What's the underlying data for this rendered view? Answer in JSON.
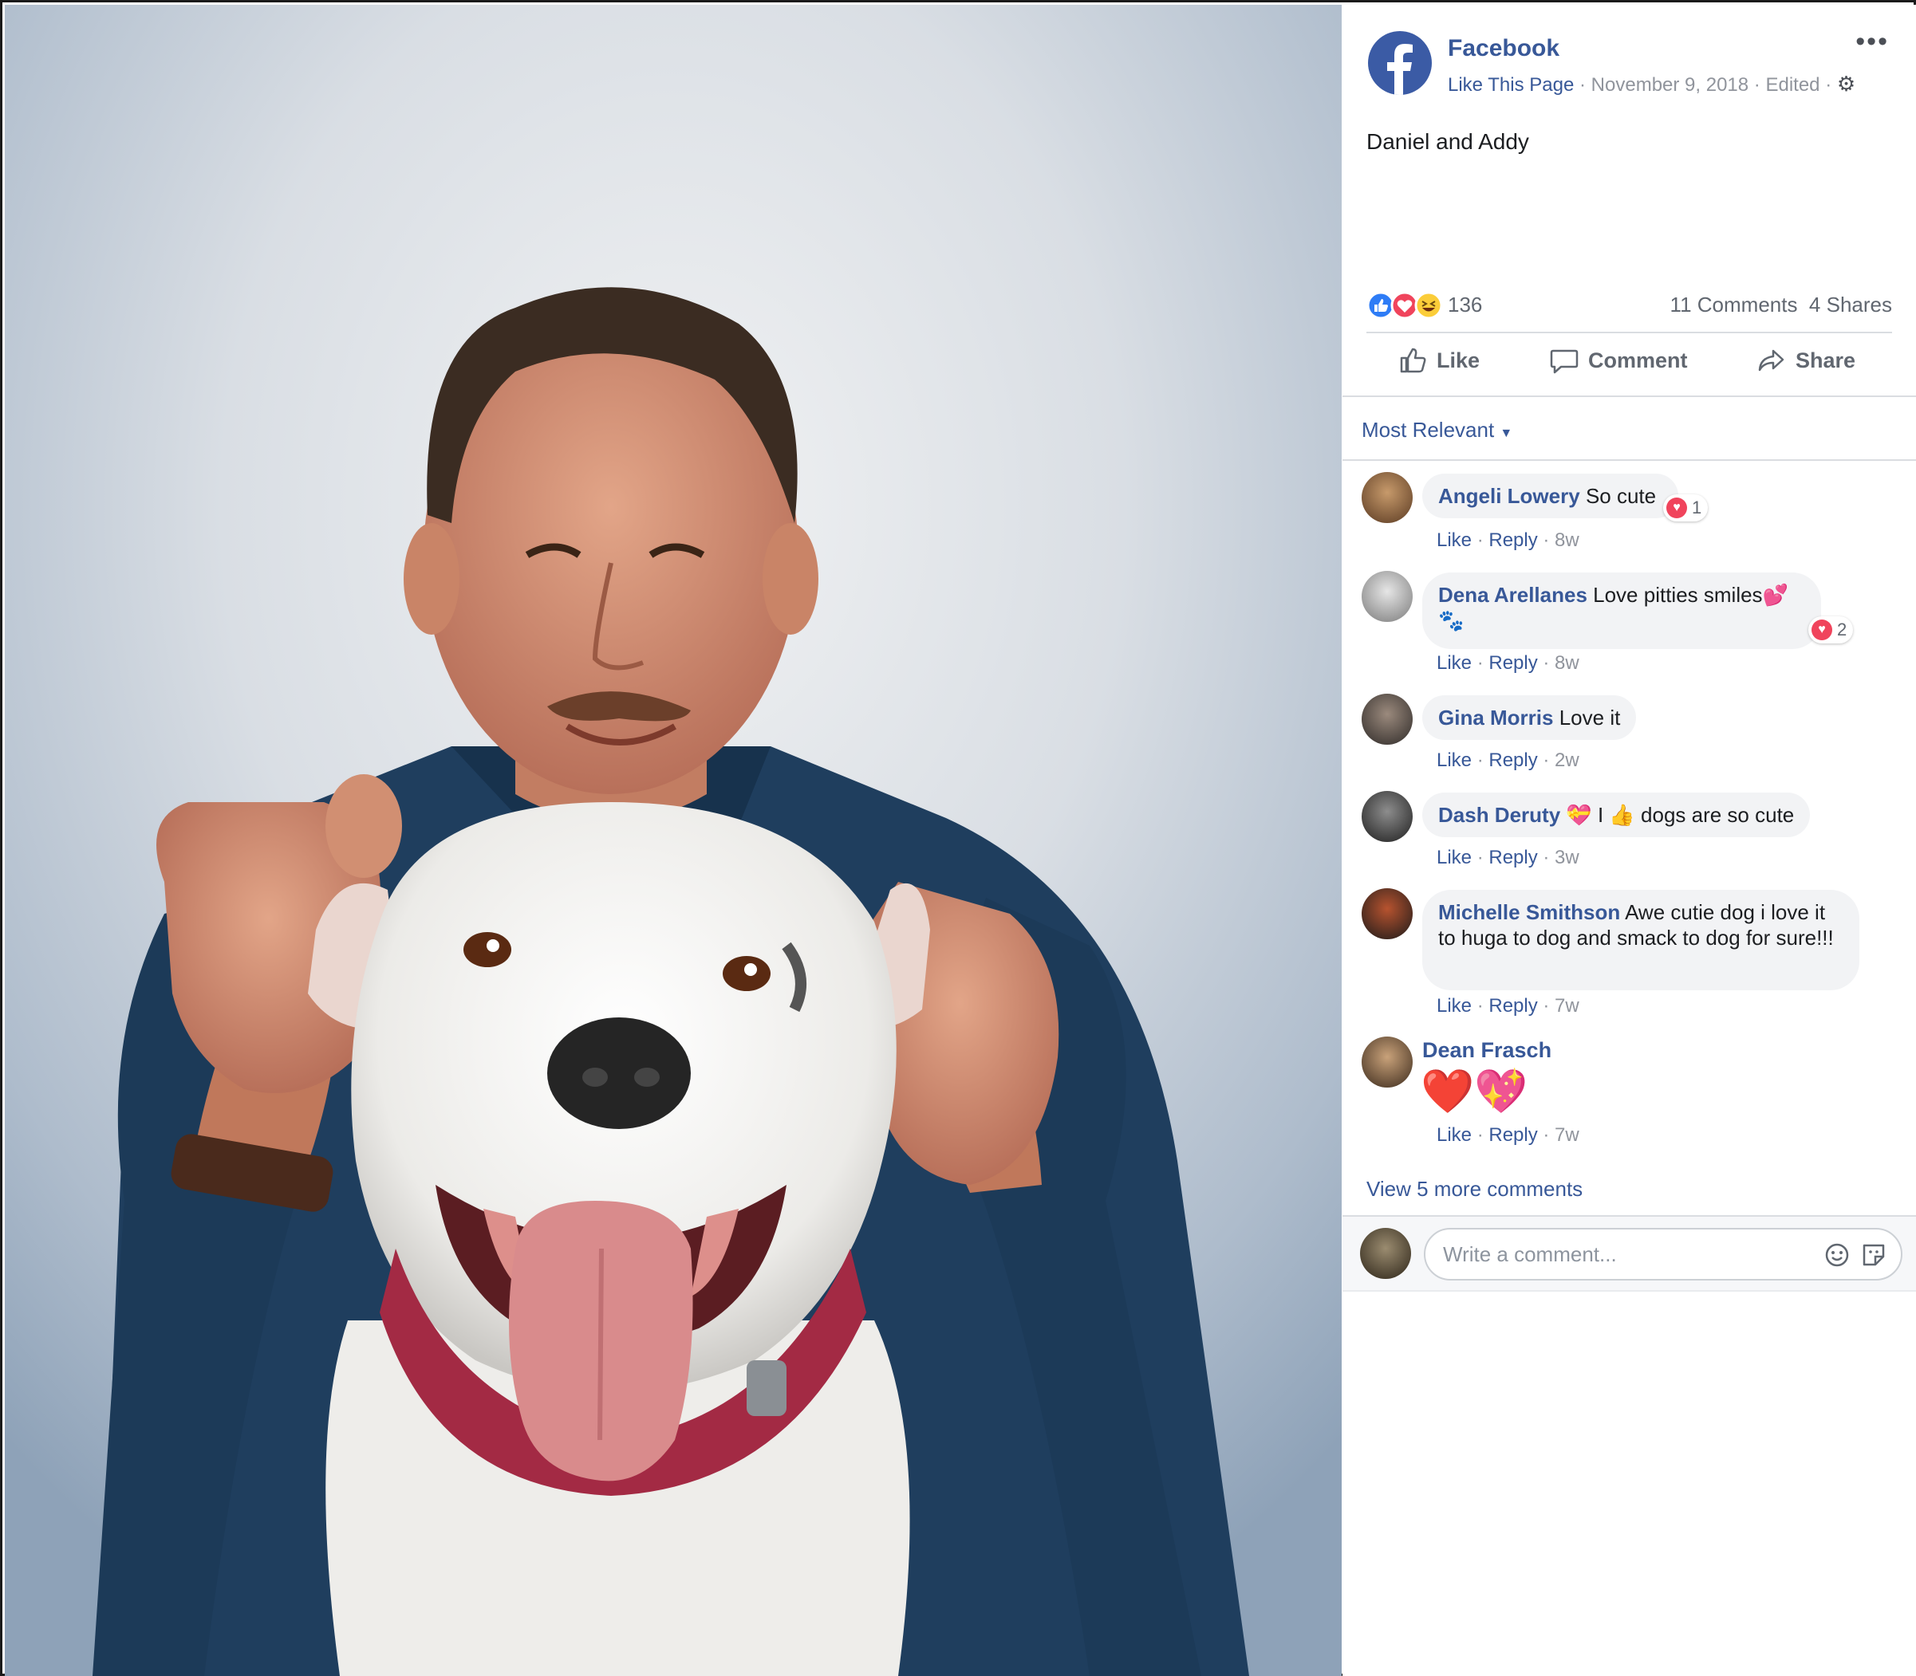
{
  "post": {
    "page_name": "Facebook",
    "like_page": "Like This Page",
    "date": "November 9, 2018",
    "edited": "Edited",
    "separator": "·",
    "text": "Daniel and Addy",
    "reaction_count": "136",
    "comments_count": "11 Comments",
    "shares_count": "4 Shares",
    "reactions": [
      "like-icon",
      "love-icon",
      "haha-icon"
    ]
  },
  "actions": {
    "like": "Like",
    "comment": "Comment",
    "share": "Share"
  },
  "sort": {
    "label": "Most Relevant"
  },
  "comments": [
    {
      "author": "Angeli Lowery",
      "text": "So cute",
      "reaction_count": "1",
      "time": "8w"
    },
    {
      "author": "Dena Arellanes",
      "text": "Love pitties smiles💕🐾",
      "reaction_count": "2",
      "time": "8w"
    },
    {
      "author": "Gina Morris",
      "text": "Love it",
      "time": "2w"
    },
    {
      "author": "Dash Deruty",
      "text": "💝 I 👍 dogs are so cute",
      "time": "3w"
    },
    {
      "author": "Michelle Smithson",
      "text": "Awe cutie dog i love it to huga to dog and smack to dog for sure!!!",
      "time": "7w"
    },
    {
      "author": "Dean Frasch",
      "text": "❤️💖",
      "time": "7w"
    }
  ],
  "comment_actions": {
    "like": "Like",
    "reply": "Reply"
  },
  "view_more": "View 5 more comments",
  "composer": {
    "placeholder": "Write a comment..."
  },
  "colors": {
    "link": "#385898",
    "brand": "#3b5ba5",
    "love": "#f0445c",
    "text_grey": "#90949c"
  }
}
